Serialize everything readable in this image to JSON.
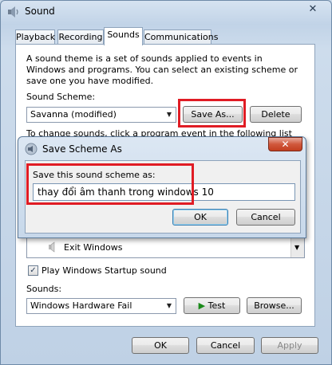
{
  "window": {
    "title": "Sound",
    "close_glyph": "✕"
  },
  "tabs": [
    {
      "label": "Playback"
    },
    {
      "label": "Recording"
    },
    {
      "label": "Sounds"
    },
    {
      "label": "Communications"
    }
  ],
  "sounds_tab": {
    "description": "A sound theme is a set of sounds applied to events in Windows and programs.  You can select an existing scheme or save one you have modified.",
    "scheme_label": "Sound Scheme:",
    "scheme_value": "Savanna (modified)",
    "save_as_label": "Save As...",
    "delete_label": "Delete",
    "events_text": "To change sounds, click a program event in the following list and",
    "event_item": "Exit Windows",
    "startup_label": "Play Windows Startup sound",
    "startup_checked": "✓",
    "sounds_label": "Sounds:",
    "sound_value": "Windows Hardware Fail",
    "test_label": "Test",
    "browse_label": "Browse..."
  },
  "footer": {
    "ok_label": "OK",
    "cancel_label": "Cancel",
    "apply_label": "Apply"
  },
  "dialog": {
    "title": "Save Scheme As",
    "close_glyph": "✕",
    "prompt": "Save this sound scheme as:",
    "input_value": "thay đổi âm thanh trong windows 10",
    "ok_label": "OK",
    "cancel_label": "Cancel"
  },
  "colors": {
    "highlight": "#e01c24",
    "accent": "#3c7fb1"
  },
  "icons": [
    "speaker-icon",
    "close-icon",
    "chevron-down-icon",
    "play-icon",
    "checkbox-icon"
  ]
}
